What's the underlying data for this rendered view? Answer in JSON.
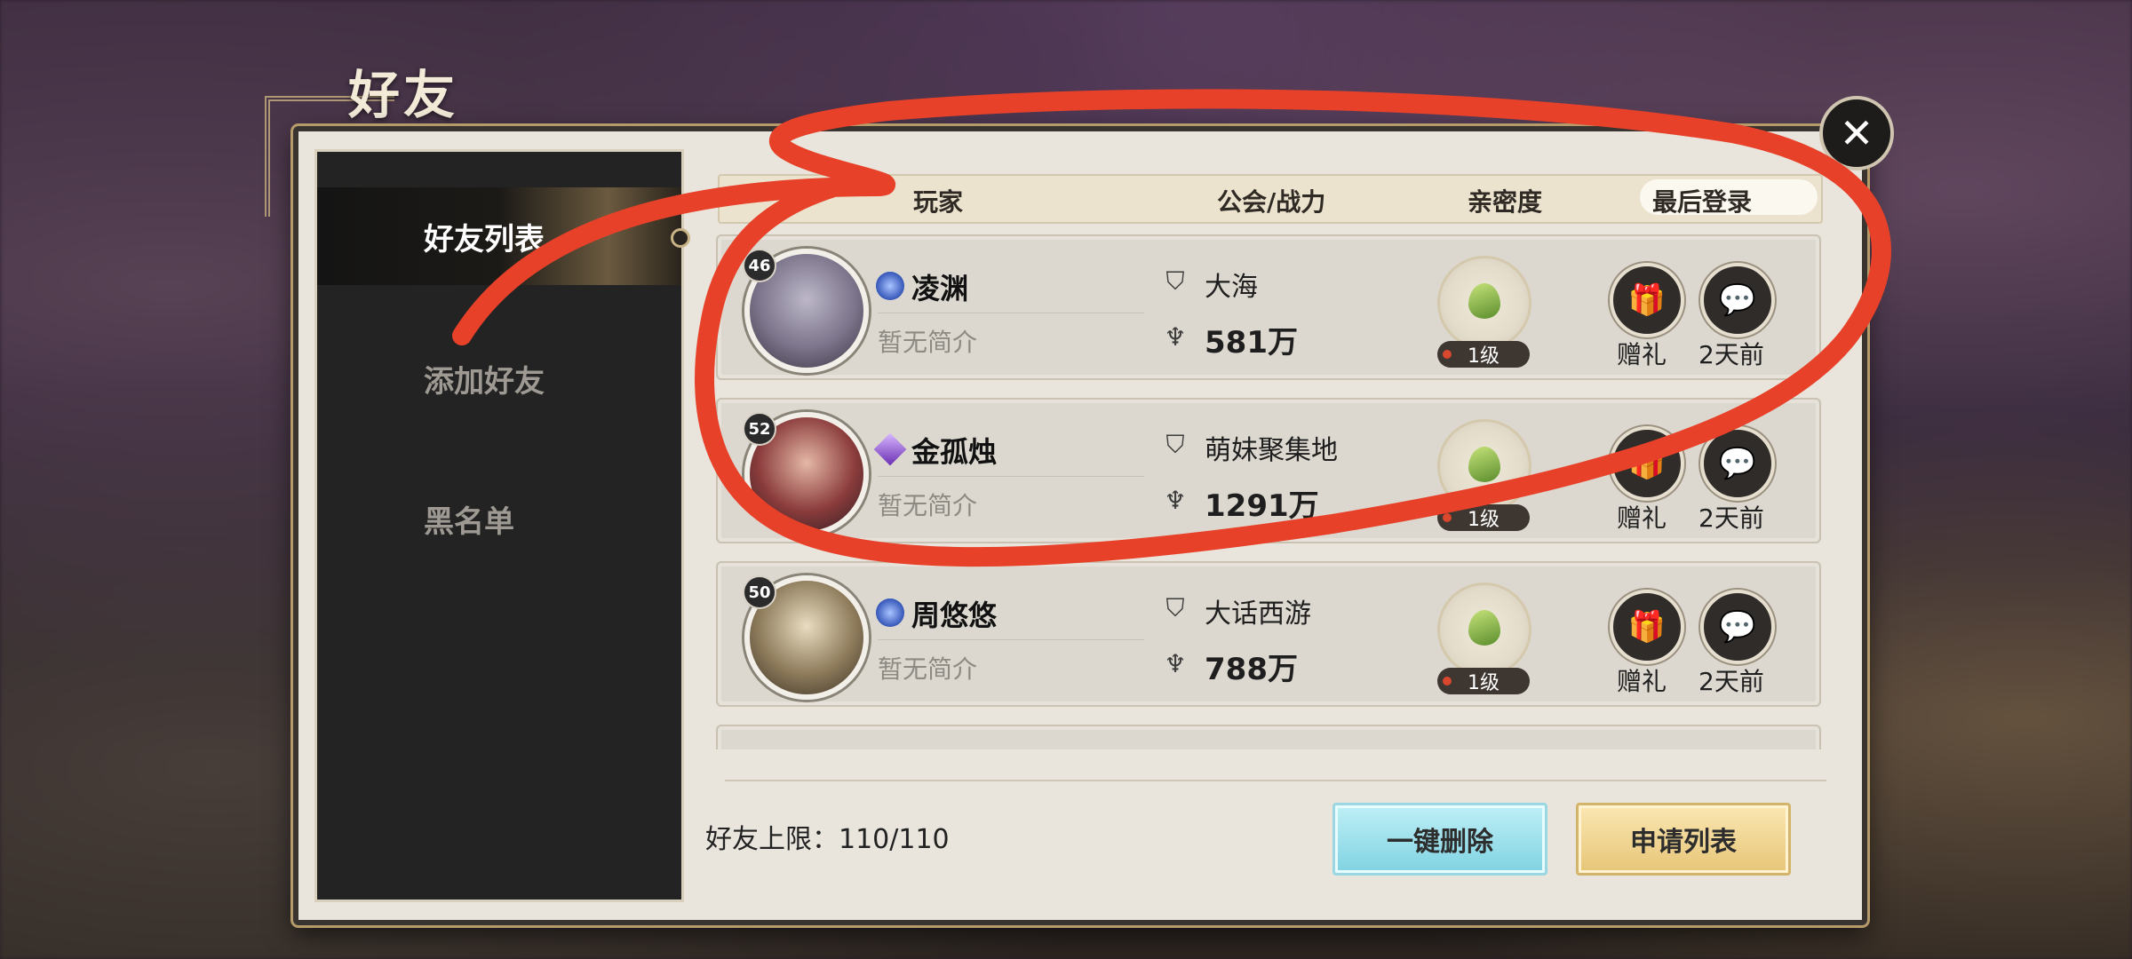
{
  "title": "好友",
  "close_icon": "close-icon",
  "sidebar": {
    "items": [
      {
        "label": "好友列表",
        "active": true
      },
      {
        "label": "添加好友",
        "active": false
      },
      {
        "label": "黑名单",
        "active": false
      }
    ]
  },
  "header": {
    "col_player": "玩家",
    "col_guild_power": "公会/战力",
    "col_intimacy": "亲密度",
    "col_last_login": "最后登录"
  },
  "friends": [
    {
      "level": "46",
      "name": "凌渊",
      "intro": "暂无简介",
      "guild": "大海",
      "power": "581万",
      "intimacy": "1级",
      "gift": "赠礼",
      "last_login": "2天前"
    },
    {
      "level": "52",
      "name": "金孤烛",
      "intro": "暂无简介",
      "guild": "萌妹聚集地",
      "power": "1291万",
      "intimacy": "1级",
      "gift": "赠礼",
      "last_login": "2天前"
    },
    {
      "level": "50",
      "name": "周悠悠",
      "intro": "暂无简介",
      "guild": "大话西游",
      "power": "788万",
      "intimacy": "1级",
      "gift": "赠礼",
      "last_login": "2天前"
    }
  ],
  "footer": {
    "limit": "好友上限：110/110",
    "delete_button": "一键删除",
    "apply_button": "申请列表"
  },
  "colors": {
    "annotation_stroke": "#e8412a"
  }
}
